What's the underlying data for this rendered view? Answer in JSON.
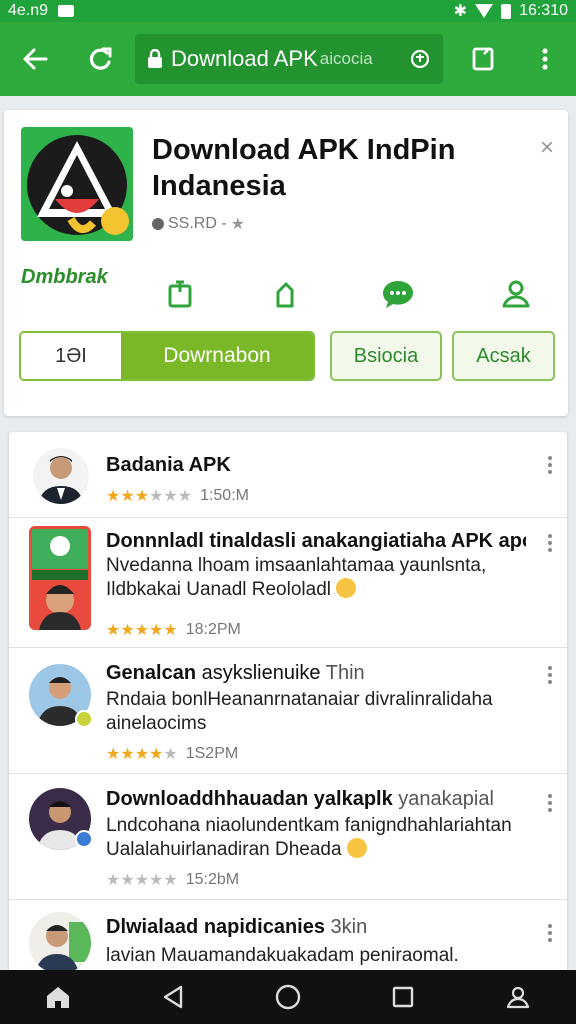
{
  "status_bar": {
    "time_left": "4e.n9",
    "time_right": "16:310"
  },
  "toolbar": {
    "url_title": "Download APK",
    "url_suffix": "aicocia"
  },
  "app": {
    "title": "Download APK IndPin Indanesia",
    "meta": "SS.RD -",
    "brand": "Dmbbrak",
    "download_count": "1ƏI",
    "download_label": "Dowrnabon",
    "button2_label": "Bsiocia",
    "button3_label": "Acsak"
  },
  "reviews": [
    {
      "name": "Badania APK",
      "stars": 3,
      "time": "1:50:M"
    },
    {
      "title": "Donnnladl tinaldasli anakangiatiaha APK apo",
      "body": "Nvedanna lhoam imsaanlahtamaa yaunlsnta, Ildbkakai Uanadl Reololadl",
      "stars": 5,
      "time": "18:2PM"
    },
    {
      "title_bold": "Genalcan",
      "title_rest": "asykslienuike",
      "title_light": "Thin",
      "body": "Rndaia bonlHeananrnatanaiar divralinralidaha ainelaocims",
      "stars": 4,
      "time": "1S2PM"
    },
    {
      "title_bold": "Downloaddhhauadan yalkaplk",
      "title_light": "yanakapial",
      "body": "Lndcohana niaolundentkam fanigndhahlariahtan Ualalahuirlanadiran  Dheada",
      "stars": 0,
      "time": "15:2bM"
    },
    {
      "title_bold": "Dlwialaad napidicanies",
      "title_light": "3kin",
      "body": "lavian Mauamandakuakadam  peniraomal."
    }
  ],
  "colors": {
    "header": "#2eab3c",
    "accent": "#7ab827",
    "star": "#f2a81d"
  }
}
